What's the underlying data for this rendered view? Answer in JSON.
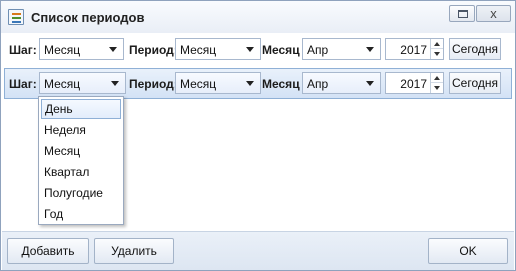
{
  "window": {
    "title": "Список периодов",
    "icon": "app-list-icon",
    "close_glyph": "x"
  },
  "rows": [
    {
      "step_label": "Шаг:",
      "step_value": "Месяц",
      "period_label": "Период:",
      "period_value": "Месяц",
      "month_label": "Месяц",
      "month_value": "Апр",
      "year_value": "2017",
      "today_label": "Сегодня"
    },
    {
      "step_label": "Шаг:",
      "step_value": "Месяц",
      "period_label": "Период:",
      "period_value": "Месяц",
      "month_label": "Месяц",
      "month_value": "Апр",
      "year_value": "2017",
      "today_label": "Сегодня"
    }
  ],
  "step_dropdown": {
    "selected": "День",
    "options": [
      "День",
      "Неделя",
      "Месяц",
      "Квартал",
      "Полугодие",
      "Год"
    ]
  },
  "footer": {
    "add_label": "Добавить",
    "delete_label": "Удалить",
    "ok_label": "OK"
  },
  "colors": {
    "active_row": "#d3e2f5",
    "border": "#8fa2bd"
  }
}
